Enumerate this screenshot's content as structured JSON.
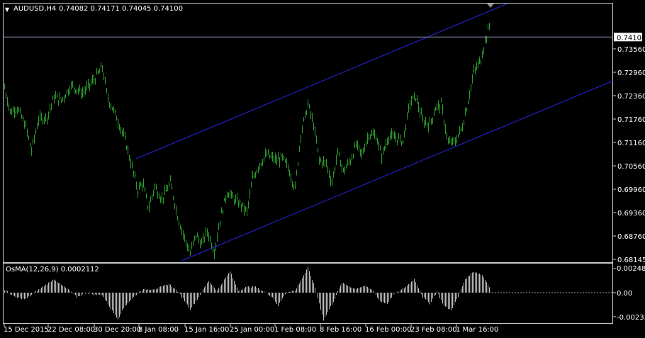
{
  "header": {
    "symbol_tf": "AUDUSD,H4",
    "ohlc": "0.74082 0.74171 0.74045 0.74100"
  },
  "indicator": {
    "label": "OsMA(12,26,9) 0.0002112",
    "ticks": [
      "0.002488",
      "0.00",
      "-0.002336"
    ],
    "ymax": 0.002488,
    "ymin": -0.002336
  },
  "colors": {
    "bars": "#2e9c2e",
    "channel": "#2626e0",
    "osma": "#c0c0c0",
    "price_line": "#8c8cb4"
  },
  "chart_data": {
    "type": "bar",
    "symbol": "AUDUSD",
    "timeframe": "H4",
    "ylim": [
      0.681,
      0.746
    ],
    "yticks": [
      "0.74100",
      "0.73560",
      "0.72960",
      "0.72360",
      "0.71760",
      "0.71160",
      "0.70560",
      "0.69960",
      "0.69360",
      "0.68760",
      "0.68145"
    ],
    "current_price": "0.74100",
    "xticks": [
      "15 Dec 2015",
      "22 Dec 08:00",
      "30 Dec 20:00",
      "8 Jan 08:00",
      "15 Jan 16:00",
      "25 Jan 00:00",
      "1 Feb 08:00",
      "8 Feb 16:00",
      "16 Feb 00:00",
      "23 Feb 08:00",
      "1 Mar 16:00"
    ],
    "path": [
      [
        0,
        0.7275
      ],
      [
        8,
        0.721
      ],
      [
        18,
        0.722
      ],
      [
        30,
        0.717
      ],
      [
        38,
        0.7105
      ],
      [
        48,
        0.719
      ],
      [
        60,
        0.7195
      ],
      [
        70,
        0.725
      ],
      [
        80,
        0.724
      ],
      [
        94,
        0.728
      ],
      [
        110,
        0.726
      ],
      [
        128,
        0.73
      ],
      [
        138,
        0.733
      ],
      [
        145,
        0.725
      ],
      [
        158,
        0.7195
      ],
      [
        170,
        0.7135
      ],
      [
        180,
        0.706
      ],
      [
        188,
        0.7
      ],
      [
        195,
        0.702
      ],
      [
        203,
        0.695
      ],
      [
        212,
        0.701
      ],
      [
        222,
        0.6975
      ],
      [
        234,
        0.702
      ],
      [
        244,
        0.693
      ],
      [
        254,
        0.687
      ],
      [
        262,
        0.683
      ],
      [
        270,
        0.688
      ],
      [
        278,
        0.6855
      ],
      [
        286,
        0.689
      ],
      [
        296,
        0.6835
      ],
      [
        304,
        0.692
      ],
      [
        314,
        0.6995
      ],
      [
        324,
        0.6975
      ],
      [
        334,
        0.696
      ],
      [
        342,
        0.694
      ],
      [
        350,
        0.703
      ],
      [
        360,
        0.707
      ],
      [
        370,
        0.7095
      ],
      [
        382,
        0.708
      ],
      [
        392,
        0.7085
      ],
      [
        400,
        0.706
      ],
      [
        410,
        0.7005
      ],
      [
        418,
        0.715
      ],
      [
        428,
        0.723
      ],
      [
        436,
        0.7175
      ],
      [
        444,
        0.708
      ],
      [
        454,
        0.707
      ],
      [
        462,
        0.702
      ],
      [
        470,
        0.71
      ],
      [
        478,
        0.705
      ],
      [
        488,
        0.708
      ],
      [
        496,
        0.712
      ],
      [
        504,
        0.7095
      ],
      [
        514,
        0.715
      ],
      [
        524,
        0.7145
      ],
      [
        532,
        0.709
      ],
      [
        542,
        0.7145
      ],
      [
        552,
        0.714
      ],
      [
        562,
        0.713
      ],
      [
        572,
        0.7235
      ],
      [
        580,
        0.725
      ],
      [
        590,
        0.7185
      ],
      [
        600,
        0.7175
      ],
      [
        608,
        0.722
      ],
      [
        616,
        0.723
      ],
      [
        626,
        0.7125
      ],
      [
        636,
        0.713
      ],
      [
        646,
        0.717
      ],
      [
        654,
        0.724
      ],
      [
        662,
        0.7315
      ],
      [
        672,
        0.735
      ],
      [
        678,
        0.74
      ],
      [
        684,
        0.744
      ],
      [
        690,
        0.741
      ]
    ],
    "osma_path": [
      [
        0,
        0.0003
      ],
      [
        14,
        -0.0004
      ],
      [
        30,
        -0.0006
      ],
      [
        50,
        0.0004
      ],
      [
        70,
        0.0014
      ],
      [
        80,
        0.0008
      ],
      [
        92,
        0.0002
      ],
      [
        102,
        -0.0004
      ],
      [
        115,
        0.0
      ],
      [
        128,
        -0.0002
      ],
      [
        138,
        -0.0002
      ],
      [
        150,
        -0.0015
      ],
      [
        160,
        -0.0024
      ],
      [
        170,
        -0.0012
      ],
      [
        182,
        -0.0004
      ],
      [
        194,
        0.0003
      ],
      [
        214,
        0.0004
      ],
      [
        232,
        0.0009
      ],
      [
        246,
        0.0
      ],
      [
        262,
        -0.0015
      ],
      [
        274,
        -0.0004
      ],
      [
        288,
        0.0012
      ],
      [
        300,
        0.0002
      ],
      [
        318,
        0.0022
      ],
      [
        330,
        0.0002
      ],
      [
        342,
        0.0006
      ],
      [
        354,
        0.0006
      ],
      [
        366,
        0.0001
      ],
      [
        378,
        -0.0004
      ],
      [
        386,
        -0.0012
      ],
      [
        398,
        0.0001
      ],
      [
        410,
        0.0002
      ],
      [
        428,
        0.0026
      ],
      [
        438,
        0.0005
      ],
      [
        450,
        -0.0025
      ],
      [
        464,
        -0.0008
      ],
      [
        476,
        0.001
      ],
      [
        494,
        0.0004
      ],
      [
        508,
        0.0007
      ],
      [
        520,
        0.0002
      ],
      [
        530,
        -0.0008
      ],
      [
        540,
        -0.001
      ],
      [
        548,
        -0.0002
      ],
      [
        558,
        0.0002
      ],
      [
        566,
        0.0006
      ],
      [
        578,
        0.0014
      ],
      [
        590,
        -0.0004
      ],
      [
        600,
        -0.001
      ],
      [
        610,
        0.0001
      ],
      [
        620,
        -0.0012
      ],
      [
        630,
        -0.0016
      ],
      [
        640,
        -0.0004
      ],
      [
        650,
        0.0014
      ],
      [
        662,
        0.0022
      ],
      [
        674,
        0.0018
      ],
      [
        686,
        0.0004
      ],
      [
        690,
        0.0002
      ]
    ]
  }
}
